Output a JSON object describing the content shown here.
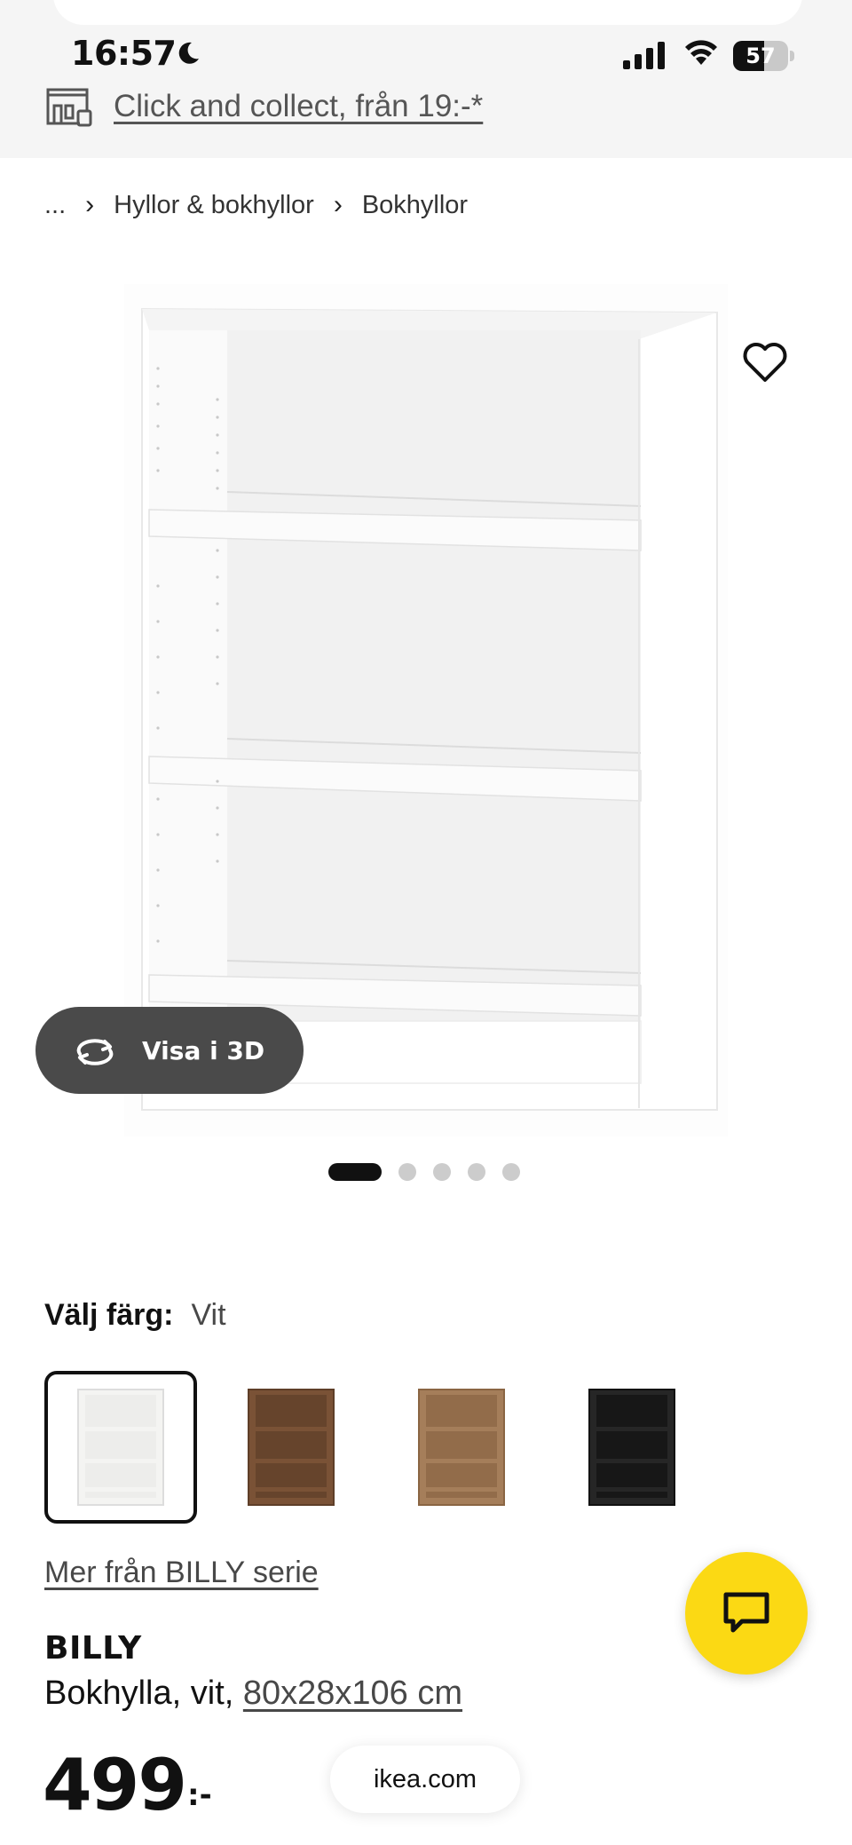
{
  "status_bar": {
    "time": "16:57",
    "battery_percent": "57",
    "battery_level": 0.57
  },
  "banner": {
    "collect_text": "Click and collect, från 19:-*"
  },
  "breadcrumb": {
    "ellipsis": "...",
    "items": [
      "Hyllor & bokhyllor",
      "Bokhyllor"
    ]
  },
  "gallery": {
    "visa3d_label": "Visa i 3D",
    "total_images": 5,
    "active_index": 0
  },
  "color_picker": {
    "label": "Välj färg:",
    "selected": "Vit",
    "swatches": [
      {
        "color": "#f4f4f2",
        "shelf": "#e6e6e3"
      },
      {
        "color": "#7a5236",
        "shelf": "#5e3e28"
      },
      {
        "color": "#a57e5a",
        "shelf": "#8a6543"
      },
      {
        "color": "#262626",
        "shelf": "#111111"
      }
    ]
  },
  "series_link": "Mer från BILLY serie",
  "product": {
    "name": "BILLY",
    "description": "Bokhylla, vit, ",
    "size": "80x28x106 cm",
    "price": "499",
    "price_suffix": ":-"
  },
  "browser": {
    "url": "ikea.com"
  },
  "colors": {
    "chat_fab": "#fbd914",
    "visa3d_bg": "#4a4a4a"
  }
}
